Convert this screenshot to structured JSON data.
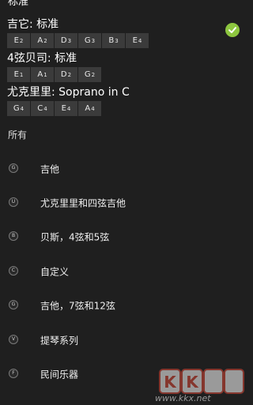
{
  "header": {
    "title_partial": "标准"
  },
  "tunings": [
    {
      "title": "吉它: 标准",
      "notes": [
        {
          "n": "E",
          "s": "2"
        },
        {
          "n": "A",
          "s": "2"
        },
        {
          "n": "D",
          "s": "3"
        },
        {
          "n": "G",
          "s": "3"
        },
        {
          "n": "B",
          "s": "3"
        },
        {
          "n": "E",
          "s": "4"
        }
      ],
      "selected": true
    },
    {
      "title": "4弦贝司: 标准",
      "notes": [
        {
          "n": "E",
          "s": "1"
        },
        {
          "n": "A",
          "s": "1"
        },
        {
          "n": "D",
          "s": "2"
        },
        {
          "n": "G",
          "s": "2"
        }
      ]
    },
    {
      "title": "尤克里里: Soprano in C",
      "notes": [
        {
          "n": "G",
          "s": "4"
        },
        {
          "n": "C",
          "s": "4"
        },
        {
          "n": "E",
          "s": "4"
        },
        {
          "n": "A",
          "s": "4"
        }
      ]
    }
  ],
  "all_section": {
    "label": "所有",
    "items": [
      {
        "badge": "G",
        "label": "吉他"
      },
      {
        "badge": "U",
        "label": "尤克里里和四弦吉他"
      },
      {
        "badge": "B",
        "label": "贝斯，4弦和5弦"
      },
      {
        "badge": "C",
        "label": "自定义"
      },
      {
        "badge": "G",
        "label": "吉他，7弦和12弦"
      },
      {
        "badge": "V",
        "label": "提琴系列"
      },
      {
        "badge": "F",
        "label": "民间乐器"
      }
    ]
  },
  "watermark": {
    "text": "www.kkx.net"
  },
  "colors": {
    "background": "#1f1f1f",
    "chip": "#3b3b3b",
    "check": "#8dc63f"
  }
}
